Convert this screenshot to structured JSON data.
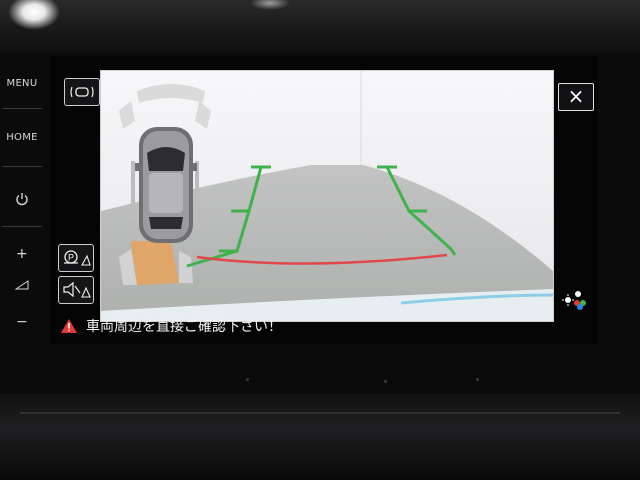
{
  "hard_keys": {
    "menu_label": "MENU",
    "home_label": "HOME",
    "power_icon": "power-icon",
    "volume_up_label": "+",
    "volume_down_label": "−",
    "volume_icon": "volume-icon"
  },
  "screen": {
    "view_toggle_icon": "parking-view-toggle-icon",
    "park_assist_icon": "park-pilot-icon",
    "mute_icon": "mute-sensor-icon",
    "close_label": "×",
    "display_settings_icon": "brightness-color-icon",
    "warning_text": "車両周辺を直接ご確認下さい！",
    "warning_icon": "warning-triangle-icon"
  },
  "colors": {
    "guide_green": "#3fb24b",
    "guide_red": "#e0474a",
    "warning_red": "#e53935",
    "sensor_orange": "#e8a25c"
  }
}
